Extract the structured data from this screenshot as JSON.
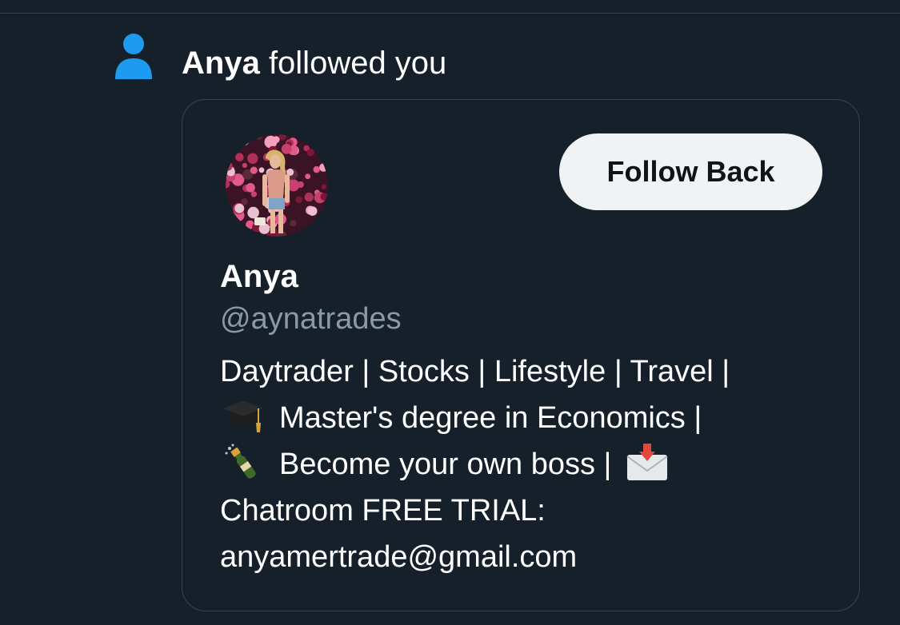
{
  "notification": {
    "icon": "person-icon",
    "actor": "Anya",
    "action": "followed you"
  },
  "profile_card": {
    "avatar": "profile-photo",
    "follow_button_label": "Follow Back",
    "name": "Anya",
    "handle": "@aynatrades",
    "bio": {
      "line1": "Daytrader | Stocks | Lifestyle | Travel |",
      "line2_emoji": "graduation-cap-emoji",
      "line2": "Master's degree in Economics |",
      "line3_emoji": "champagne-bottle-emoji",
      "line3": "Become your own boss |",
      "line3_trailing_emoji": "envelope-with-arrow-emoji",
      "line4": "Chatroom FREE TRIAL:",
      "line5": "anyamertrade@gmail.com"
    }
  },
  "colors": {
    "background": "#15202b",
    "card_border": "#38444d",
    "accent_blue": "#1d9bf0",
    "handle_gray": "#8b98a5",
    "button_bg": "#eff3f4",
    "button_text": "#0f1419"
  }
}
